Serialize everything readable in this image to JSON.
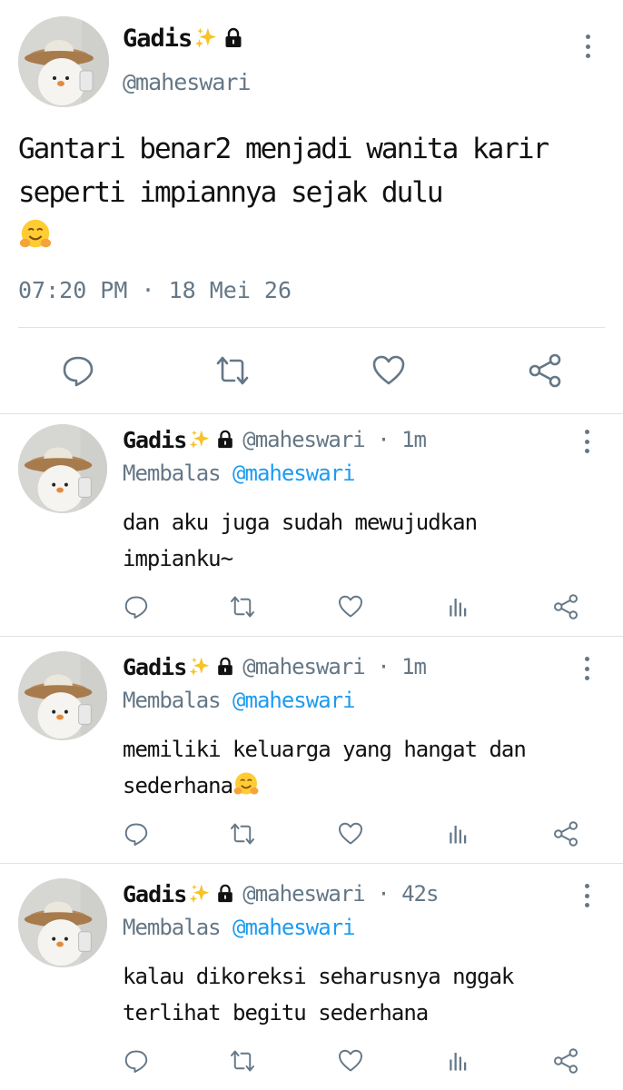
{
  "main_tweet": {
    "display_name": "Gadis",
    "handle": "@maheswari",
    "text": "Gantari benar2 menjadi wanita karir seperti impiannya sejak dulu",
    "timestamp": "07:20 PM · 18 Mei 26"
  },
  "replies": [
    {
      "display_name": "Gadis",
      "handle_time": "@maheswari · 1m",
      "replying_label": "Membalas",
      "replying_to": "@maheswari",
      "text": "dan aku juga sudah mewujudkan impianku~"
    },
    {
      "display_name": "Gadis",
      "handle_time": "@maheswari · 1m",
      "replying_label": "Membalas",
      "replying_to": "@maheswari",
      "text": "memiliki keluarga yang hangat dan sederhana"
    },
    {
      "display_name": "Gadis",
      "handle_time": "@maheswari · 42s",
      "replying_label": "Membalas",
      "replying_to": "@maheswari",
      "text": "kalau dikoreksi seharusnya nggak terlihat begitu sederhana"
    }
  ],
  "colors": {
    "text": "#111111",
    "muted": "#657786",
    "link": "#1d9bf0",
    "divider": "#dfe3e6"
  },
  "icons": [
    "sparkles-emoji",
    "lock-icon",
    "more-vertical-icon",
    "hugging-face-emoji",
    "reply-icon",
    "retweet-icon",
    "like-icon",
    "analytics-icon",
    "share-icon"
  ]
}
